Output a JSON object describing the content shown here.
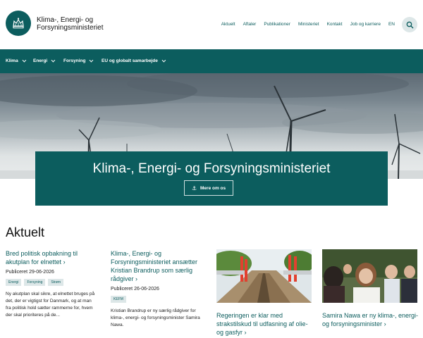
{
  "brand": {
    "line1": "Klima-, Energi- og",
    "line2": "Forsyningsministeriet"
  },
  "topnav": [
    "Aktuelt",
    "Aftaler",
    "Publikationer",
    "Ministeriet",
    "Kontakt",
    "Job og karriere",
    "EN"
  ],
  "mainnav": [
    "Klima",
    "Energi",
    "Forsyning",
    "EU og globalt samarbejde"
  ],
  "hero": {
    "title": "Klima-, Energi- og Forsyningsministeriet",
    "button": "Mere om os"
  },
  "section": {
    "title": "Aktuelt"
  },
  "news": [
    {
      "title": "Bred politisk opbakning til akutplan for elnettet",
      "published": "Publiceret 29-06-2026",
      "tags": [
        "Energi",
        "Forsyning",
        "Strøm"
      ],
      "excerpt": "Ny akutplan skal sikre, at elnettet bruges på det, der er vigtigst for Danmark, og at man fra politisk hold sætter rammerne for, hvem der skal prioriteres på de..."
    },
    {
      "title": "Klima-, Energi- og Forsyningsministeriet ansætter Kristian Brandrup som særlig rådgiver",
      "published": "Publiceret 26-06-2026",
      "tags": [
        "KEFM"
      ],
      "excerpt": "Kristian Brandrup er ny særlig rådgiver for klima-, energi- og forsyningsminister Samira Nawa."
    },
    {
      "title": "Regeringen er klar med strakstilskud til udfasning af olie- og gasfyr"
    },
    {
      "title": "Samira Nawa er ny klima-, energi- og forsyningsminister"
    }
  ],
  "colors": {
    "primary": "#0c5d5e",
    "tag_bg": "#dde7e8"
  },
  "icons": {
    "logo": "crown-icon",
    "search": "search-icon",
    "chevron": "chevron-down-icon",
    "button": "anchor-icon"
  }
}
